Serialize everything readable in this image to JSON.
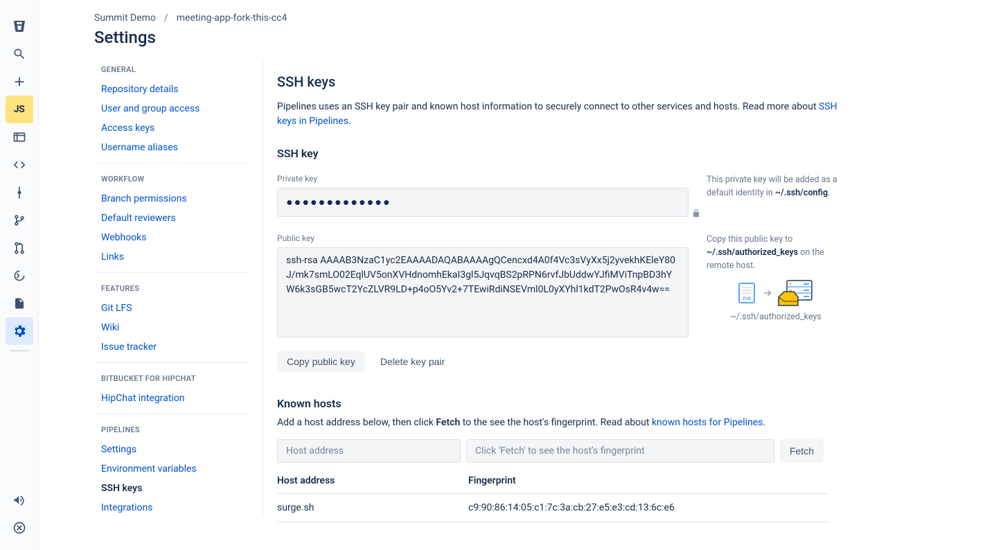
{
  "breadcrumb": {
    "project": "Summit Demo",
    "repo": "meeting-app-fork-this-cc4"
  },
  "page_title": "Settings",
  "nav": {
    "groups": [
      {
        "header": "GENERAL",
        "items": [
          {
            "label": "Repository details"
          },
          {
            "label": "User and group access"
          },
          {
            "label": "Access keys"
          },
          {
            "label": "Username aliases"
          }
        ]
      },
      {
        "header": "WORKFLOW",
        "items": [
          {
            "label": "Branch permissions"
          },
          {
            "label": "Default reviewers"
          },
          {
            "label": "Webhooks"
          },
          {
            "label": "Links"
          }
        ]
      },
      {
        "header": "FEATURES",
        "items": [
          {
            "label": "Git LFS"
          },
          {
            "label": "Wiki"
          },
          {
            "label": "Issue tracker"
          }
        ]
      },
      {
        "header": "BITBUCKET FOR HIPCHAT",
        "items": [
          {
            "label": "HipChat integration"
          }
        ]
      },
      {
        "header": "PIPELINES",
        "items": [
          {
            "label": "Settings"
          },
          {
            "label": "Environment variables"
          },
          {
            "label": "SSH keys",
            "active": true
          },
          {
            "label": "Integrations"
          }
        ]
      }
    ]
  },
  "ssh": {
    "heading": "SSH keys",
    "intro_prefix": "Pipelines uses an SSH key pair and known host information to securely connect to other services and hosts. Read more about ",
    "intro_link": "SSH keys in Pipelines",
    "intro_suffix": ".",
    "subheading": "SSH key",
    "private_label": "Private key",
    "private_value": "●●●●●●●●●●●●●",
    "private_help_prefix": "This private key will be added as a default identity in ",
    "private_help_strong": "~/.ssh/config",
    "private_help_suffix": ".",
    "public_label": "Public key",
    "public_value": "ssh-rsa AAAAB3NzaC1yc2EAAAADAQABAAAAgQCencxd4A0f4Vc3sVyXx5j2yvekhKEleY80J/mk7smLO02EqlUV5onXVHdnomhEkaI3gl5JqvqBS2pRPN6rvfJbUddwYJfiMViTnpBD3hYW6k3sGB5wcT2YcZLVR9LD+p4oO5Yv2+7TEwiRdiNSEVml0L0yXYhl1kdT2PwOsR4v4w==",
    "public_help_prefix": "Copy this public key to ",
    "public_help_strong": "~/.ssh/authorized_keys",
    "public_help_suffix": " on the remote host.",
    "ssh_diagram_caption": "~/.ssh/authorized_keys",
    "copy_btn": "Copy public key",
    "delete_btn": "Delete key pair"
  },
  "known_hosts": {
    "heading": "Known hosts",
    "text_prefix": "Add a host address below, then click ",
    "text_strong": "Fetch",
    "text_mid": " to the see the host's fingerprint. Read about ",
    "text_link": "known hosts for Pipelines",
    "text_suffix": ".",
    "host_placeholder": "Host address",
    "finger_placeholder": "Click 'Fetch' to see the host's fingerprint",
    "fetch_btn": "Fetch",
    "col_host": "Host address",
    "col_finger": "Fingerprint",
    "rows": [
      {
        "host": "surge.sh",
        "fingerprint": "c9:90:86:14:05:c1:7c:3a:cb:27:e5:e3:cd:13:6c:e6"
      }
    ]
  }
}
